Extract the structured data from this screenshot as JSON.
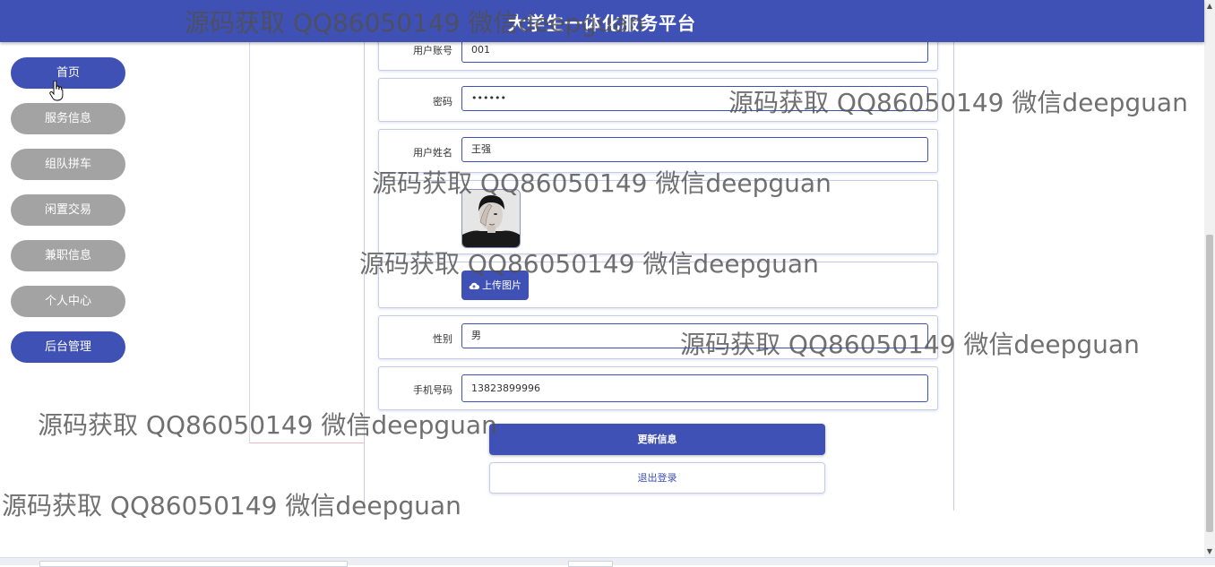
{
  "header": {
    "title": "大学生一体化服务平台"
  },
  "nav": {
    "items": [
      {
        "label": "首页",
        "active": true
      },
      {
        "label": "服务信息",
        "active": false
      },
      {
        "label": "组队拼车",
        "active": false
      },
      {
        "label": "闲置交易",
        "active": false
      },
      {
        "label": "兼职信息",
        "active": false
      },
      {
        "label": "个人中心",
        "active": false
      },
      {
        "label": "后台管理",
        "active": true
      }
    ]
  },
  "form": {
    "account": {
      "label": "用户账号",
      "value": "001"
    },
    "password": {
      "label": "密码",
      "value": "••••••"
    },
    "name": {
      "label": "用户姓名",
      "value": "王强"
    },
    "upload_label": "上传图片",
    "gender": {
      "label": "性别",
      "value": "男"
    },
    "phone": {
      "label": "手机号码",
      "value": "13823899996"
    },
    "update_button": "更新信息",
    "logout_button": "退出登录"
  },
  "watermark_text": "源码获取 QQ86050149 微信deepguan",
  "colors": {
    "primary": "#3f51b5",
    "nav_inactive": "#a3a3a3"
  }
}
